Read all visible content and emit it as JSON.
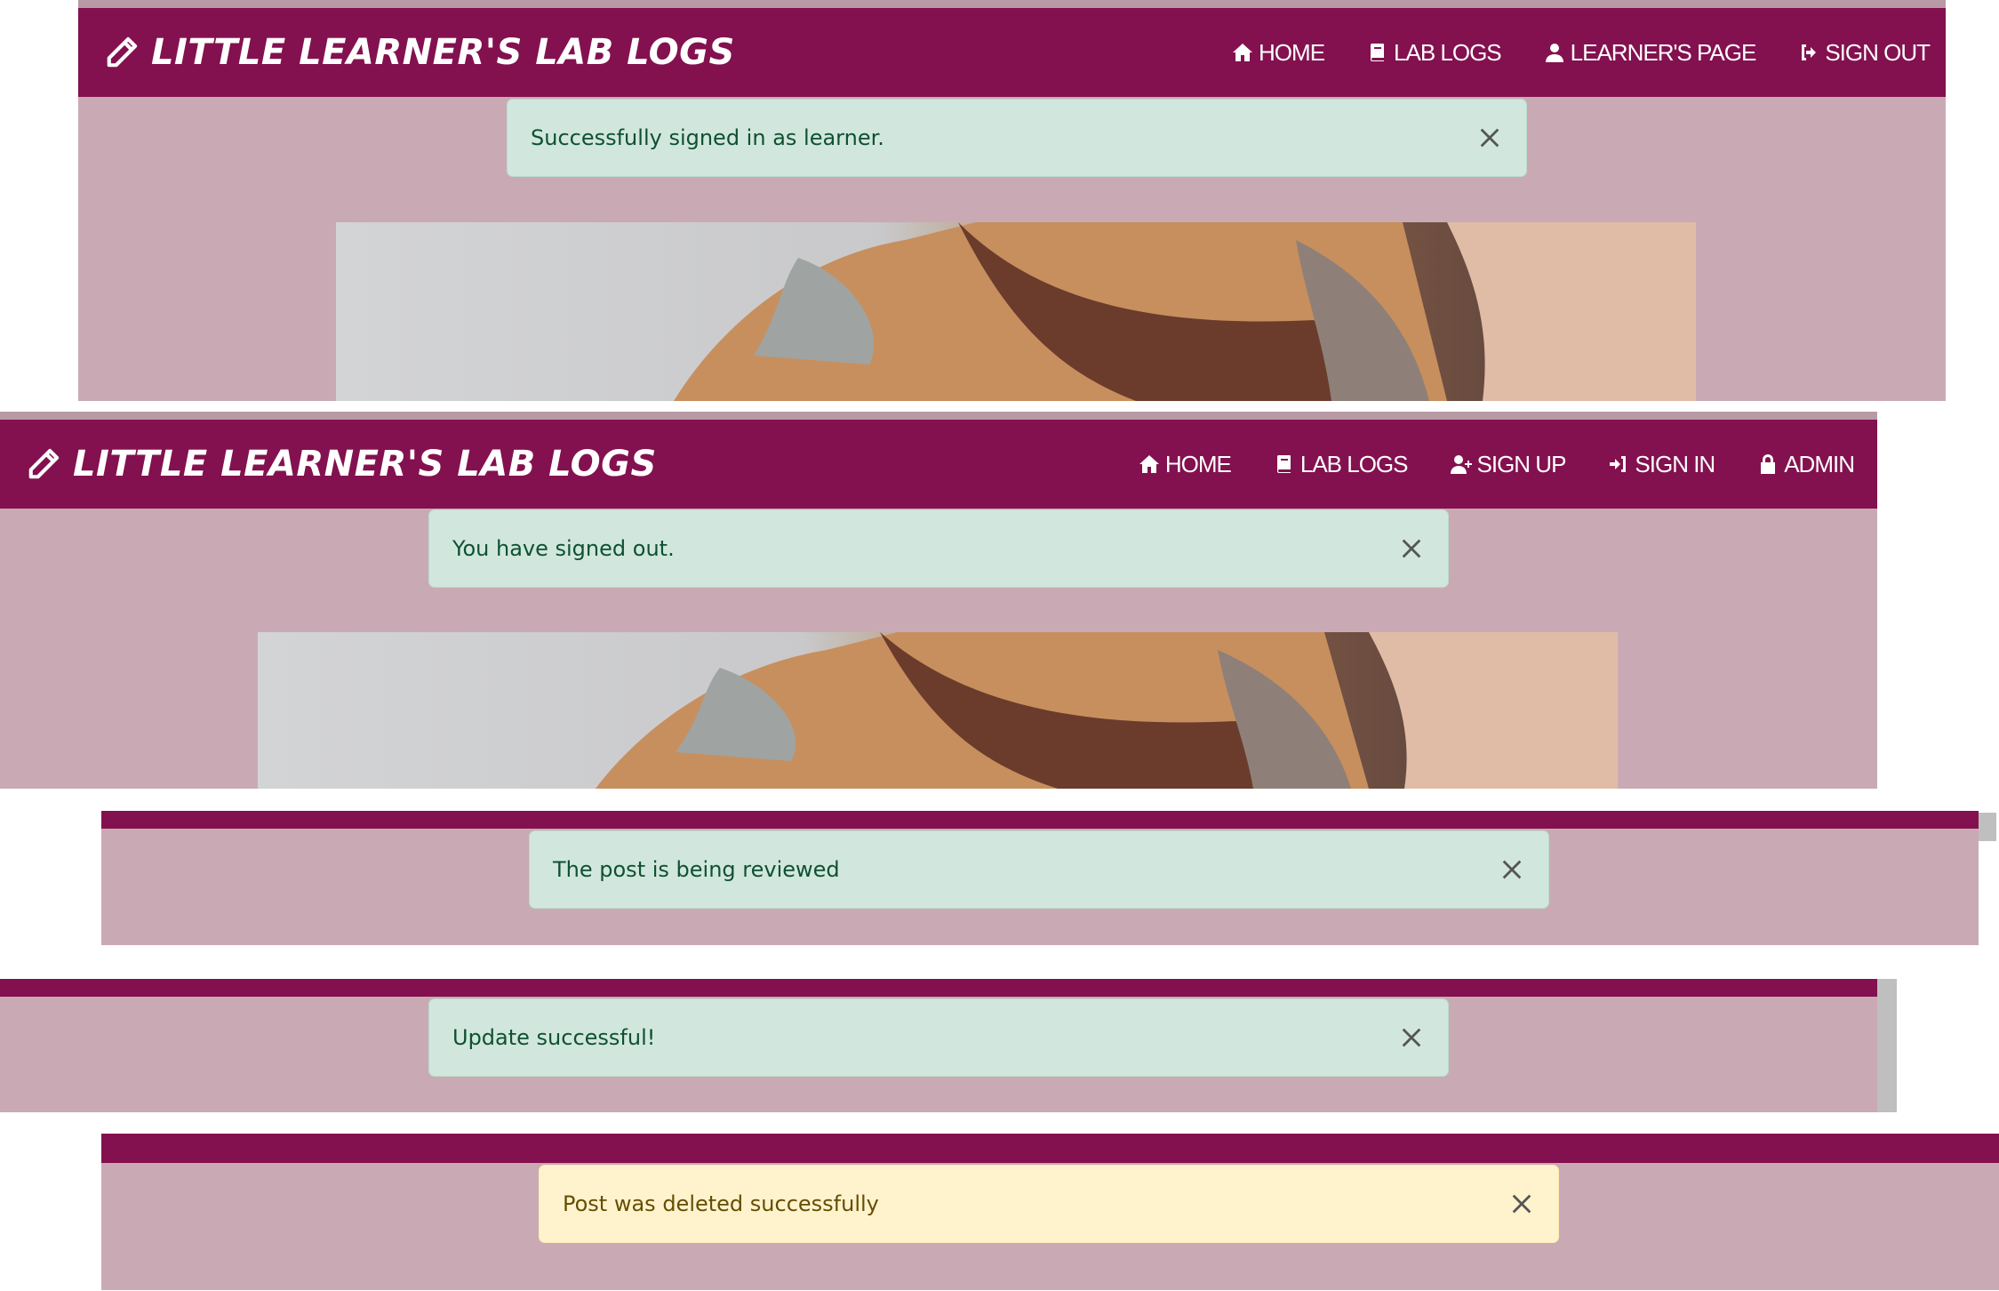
{
  "brand": {
    "title": "LITTLE LEARNER'S LAB LOGS"
  },
  "nav_signed_in": {
    "home": "HOME",
    "lab_logs": "LAB LOGS",
    "learners_page": "LEARNER'S PAGE",
    "sign_out": "SIGN OUT"
  },
  "nav_signed_out": {
    "home": "HOME",
    "lab_logs": "LAB LOGS",
    "sign_up": "SIGN UP",
    "sign_in": "SIGN IN",
    "admin": "ADMIN"
  },
  "alerts": {
    "signed_in": "Successfully signed in as learner.",
    "signed_out": "You have signed out.",
    "reviewed": "The post is being reviewed",
    "updated": "Update successful!",
    "deleted": "Post was deleted successfully"
  },
  "colors": {
    "navbar": "#83114f",
    "page_bg": "#c9aab4",
    "success_bg": "#d1e7dd",
    "success_text": "#0f5132",
    "warning_bg": "#fff3cd",
    "warning_text": "#664d03"
  }
}
